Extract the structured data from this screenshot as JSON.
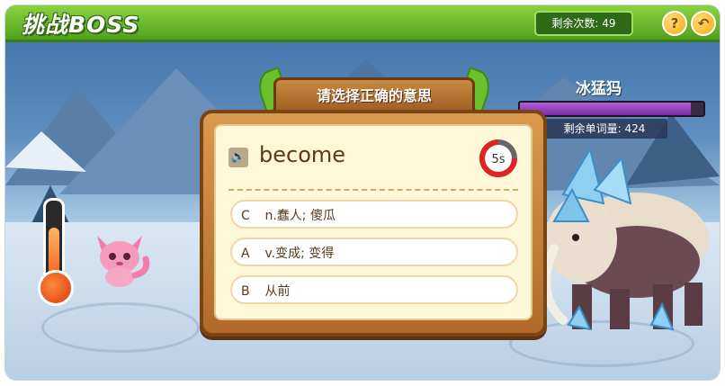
{
  "header": {
    "title": "挑战BOSS",
    "remaining_count_label": "剩余次数: 49",
    "help_icon": "question-icon",
    "back_icon": "back-arrow-icon"
  },
  "boss": {
    "name": "冰猛犸",
    "hp_fraction": 0.93,
    "remaining_words_label": "剩余单词量: 424"
  },
  "quiz": {
    "prompt": "请选择正确的意思",
    "word": "become",
    "timer": "5s",
    "options": [
      {
        "letter": "C",
        "text": "n.蠢人; 傻瓜"
      },
      {
        "letter": "A",
        "text": "v.变成; 变得"
      },
      {
        "letter": "B",
        "text": "从前"
      }
    ]
  },
  "colors": {
    "header_green": "#5db22a",
    "panel_wood": "#c6813a",
    "hp_purple": "#9a46c4",
    "timer_red": "#e02424"
  }
}
